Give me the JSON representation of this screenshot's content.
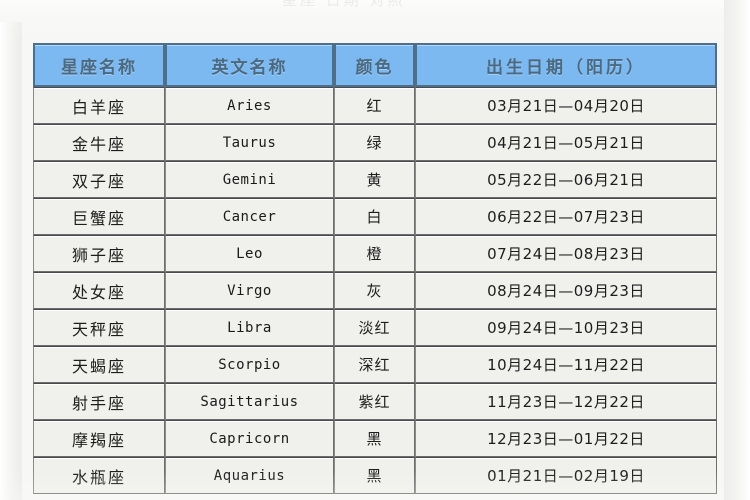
{
  "page": {
    "ghost_header_text": "星座 日期 对照"
  },
  "table": {
    "headers": [
      "星座名称",
      "英文名称",
      "颜色",
      "出生日期（阳历）"
    ],
    "rows": [
      {
        "name": "白羊座",
        "english": "Aries",
        "color": "红",
        "date": "03月21日—04月20日"
      },
      {
        "name": "金牛座",
        "english": "Taurus",
        "color": "绿",
        "date": "04月21日—05月21日"
      },
      {
        "name": "双子座",
        "english": "Gemini",
        "color": "黄",
        "date": "05月22日—06月21日"
      },
      {
        "name": "巨蟹座",
        "english": "Cancer",
        "color": "白",
        "date": "06月22日—07月23日"
      },
      {
        "name": "狮子座",
        "english": "Leo",
        "color": "橙",
        "date": "07月24日—08月23日"
      },
      {
        "name": "处女座",
        "english": "Virgo",
        "color": "灰",
        "date": "08月24日—09月23日"
      },
      {
        "name": "天秤座",
        "english": "Libra",
        "color": "淡红",
        "date": "09月24日—10月23日"
      },
      {
        "name": "天蝎座",
        "english": "Scorpio",
        "color": "深红",
        "date": "10月24日—11月22日"
      },
      {
        "name": "射手座",
        "english": "Sagittarius",
        "color": "紫红",
        "date": "11月23日—12月22日"
      },
      {
        "name": "摩羯座",
        "english": "Capricorn",
        "color": "黑",
        "date": "12月23日—01月22日"
      },
      {
        "name": "水瓶座",
        "english": "Aquarius",
        "color": "黑",
        "date": "01月21日—02月19日"
      }
    ]
  },
  "colors": {
    "header_blue": "#7cb9f0",
    "header_border": "#4e6f8c",
    "header_text": "#4b6a82",
    "cell_bg": "#f0f0ec",
    "cell_border": "#6d6d6d",
    "page_bg": "#f7f7f5"
  }
}
